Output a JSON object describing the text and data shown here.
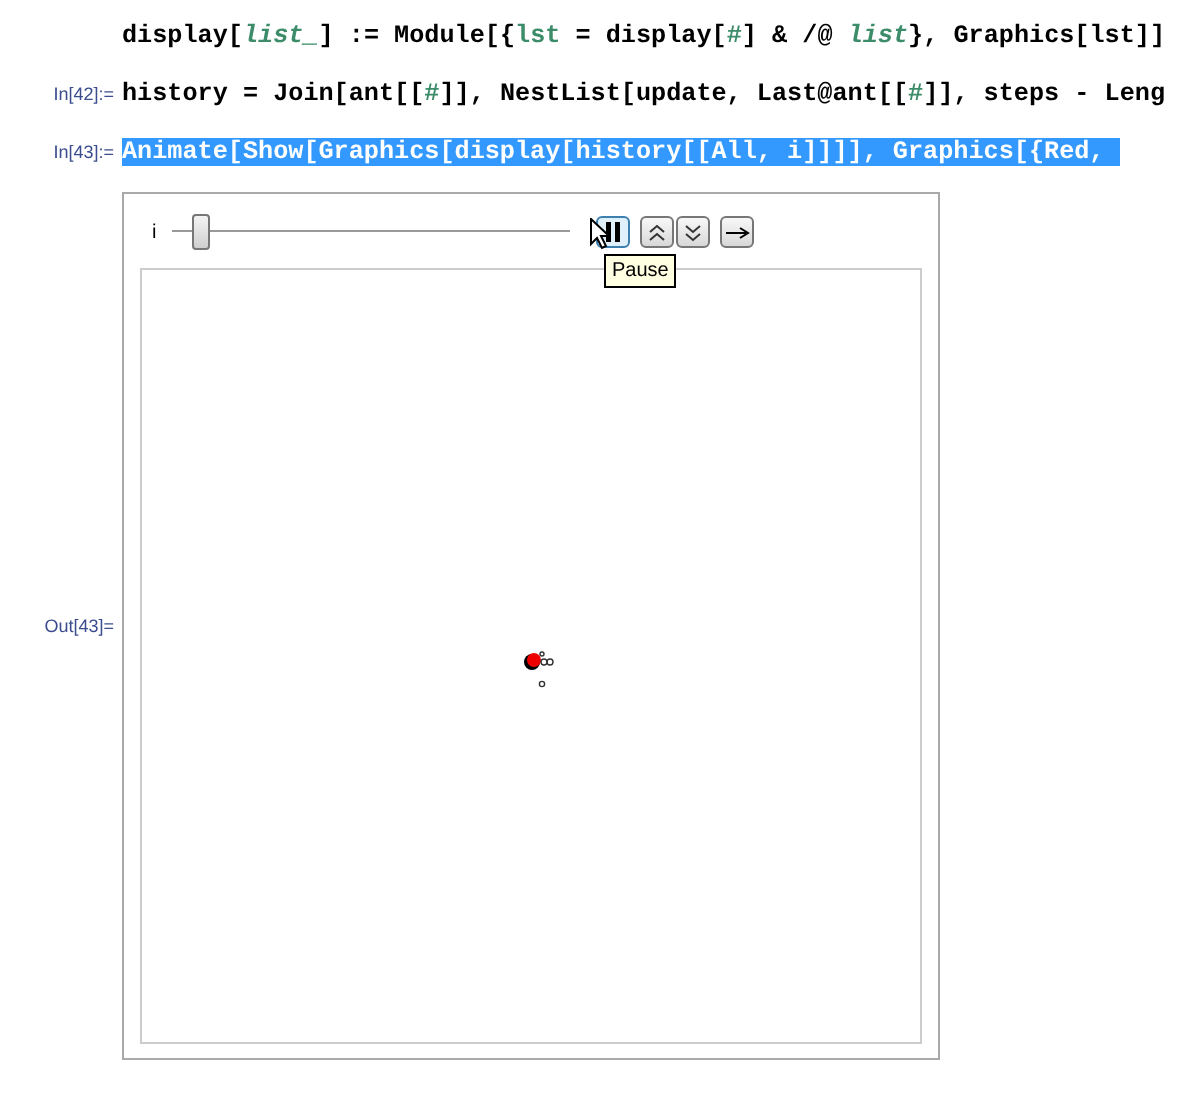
{
  "cells": [
    {
      "code": [
        {
          "kind": "plain",
          "text": "display["
        },
        {
          "kind": "pattern",
          "text": "list_"
        },
        {
          "kind": "plain",
          "text": "] := Module[{"
        },
        {
          "kind": "local",
          "text": "lst"
        },
        {
          "kind": "plain",
          "text": " = display["
        },
        {
          "kind": "local",
          "text": "#"
        },
        {
          "kind": "plain",
          "text": "] & /@ "
        },
        {
          "kind": "pattern",
          "text": "list"
        },
        {
          "kind": "plain",
          "text": "}, Graphics[lst]]"
        }
      ],
      "selected": false
    },
    {
      "label": "In[42]:=",
      "code": [
        {
          "kind": "plain",
          "text": "history = Join[ant[["
        },
        {
          "kind": "local",
          "text": "#"
        },
        {
          "kind": "plain",
          "text": "]], NestList[update, Last@ant[["
        },
        {
          "kind": "local",
          "text": "#"
        },
        {
          "kind": "plain",
          "text": "]], steps - Leng"
        }
      ],
      "selected": false
    },
    {
      "label": "In[43]:=",
      "code": [
        {
          "kind": "plain",
          "text": "Animate[Show[Graphics[display[history[[All, i]]]], Graphics[{Red, "
        }
      ],
      "selected": true
    }
  ],
  "output": {
    "label": "Out[43]=",
    "variable": "i",
    "slider": {
      "level": 0.03
    },
    "buttons": [
      {
        "kind": "pause",
        "selected": true
      },
      {
        "kind": "faster",
        "selected": false
      },
      {
        "kind": "slower",
        "selected": false
      },
      {
        "kind": "direction",
        "selected": false
      }
    ],
    "tooltip": "Pause"
  }
}
